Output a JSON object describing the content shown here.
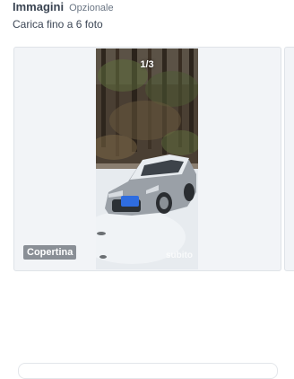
{
  "images_section": {
    "title": "Immagini",
    "optional_label": "Opzionale",
    "subtitle": "Carica fino a 6 foto"
  },
  "photo": {
    "counter": "1/3",
    "cover_label": "Copertina",
    "watermark": "subito"
  },
  "colors": {
    "card_background": "#f2f4f7",
    "badge_background": "#8a8f96"
  }
}
